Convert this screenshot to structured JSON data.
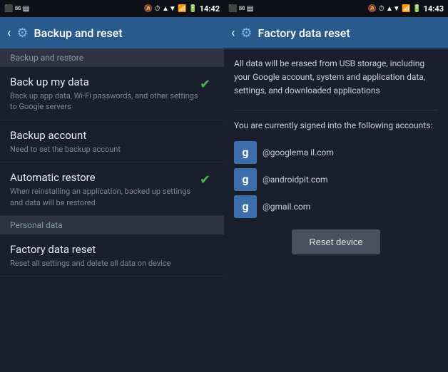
{
  "screen_left": {
    "status_bar": {
      "left_icons": "⬛▨▩",
      "time": "14:42",
      "right_icons": "🔕⏰📶📶🔋"
    },
    "header": {
      "back_icon": "‹",
      "gear_icon": "⚙",
      "title": "Backup and reset"
    },
    "section_backup": "Backup and restore",
    "items": [
      {
        "title": "Back up my data",
        "desc": "Back up app data, Wi-Fi passwords, and other settings to Google servers",
        "checked": true
      },
      {
        "title": "Backup account",
        "desc": "Need to set the backup account",
        "checked": false
      },
      {
        "title": "Automatic restore",
        "desc": "When reinstalling an application, backed up settings and data will be restored",
        "checked": true
      }
    ],
    "section_personal": "Personal data",
    "reset_item": {
      "title": "Factory data reset",
      "desc": "Reset all settings and delete all data on device"
    }
  },
  "screen_right": {
    "status_bar": {
      "left_icons": "⬛▨▩",
      "time": "14:43",
      "right_icons": "🔕⏰📶📶🔋"
    },
    "header": {
      "back_icon": "‹",
      "gear_icon": "⚙",
      "title": "Factory data reset"
    },
    "warning_text": "All data will be erased from USB storage, including your Google account, system and application data, settings, and downloaded applications",
    "signed_in_text": "You are currently signed into the following accounts:",
    "accounts": [
      "@googlema il.com",
      "@androidpit.com",
      "@gmail.com"
    ],
    "reset_button_label": "Reset device"
  }
}
